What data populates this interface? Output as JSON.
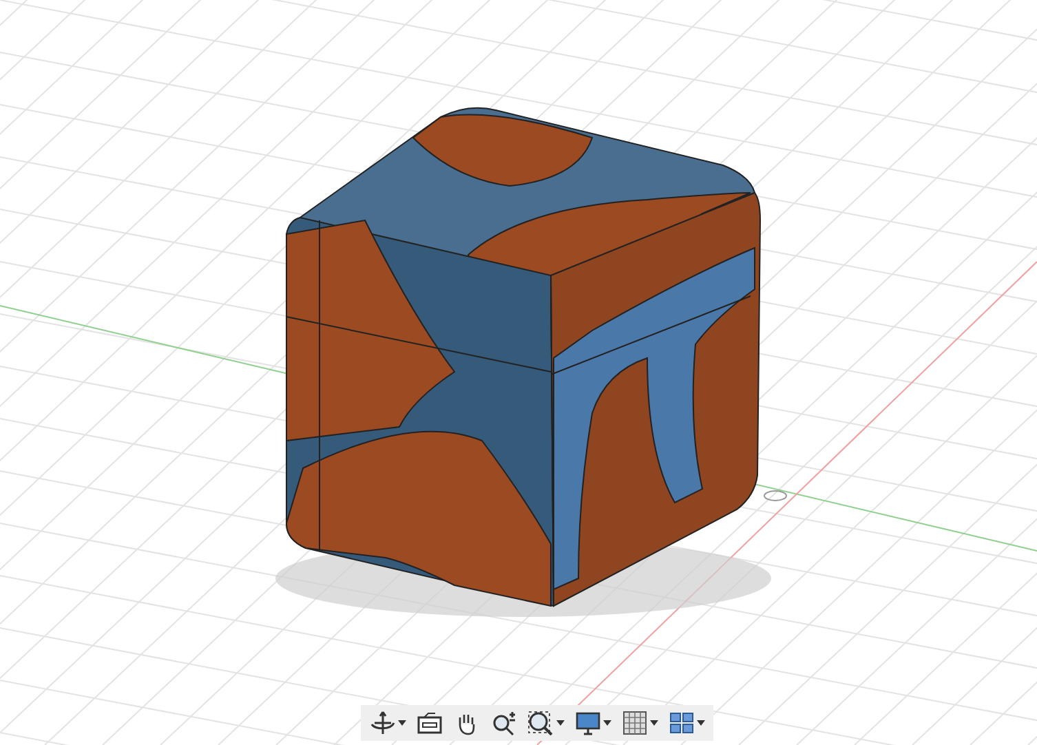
{
  "viewport": {
    "toolbar": [
      {
        "kind": "orbit",
        "dropdown": true
      },
      {
        "kind": "look",
        "dropdown": false
      },
      {
        "kind": "pan",
        "dropdown": false
      },
      {
        "kind": "zoom",
        "dropdown": false
      },
      {
        "kind": "fit",
        "dropdown": true
      },
      {
        "kind": "display",
        "dropdown": true
      },
      {
        "kind": "grid",
        "dropdown": true
      },
      {
        "kind": "viewports",
        "dropdown": true
      }
    ]
  }
}
